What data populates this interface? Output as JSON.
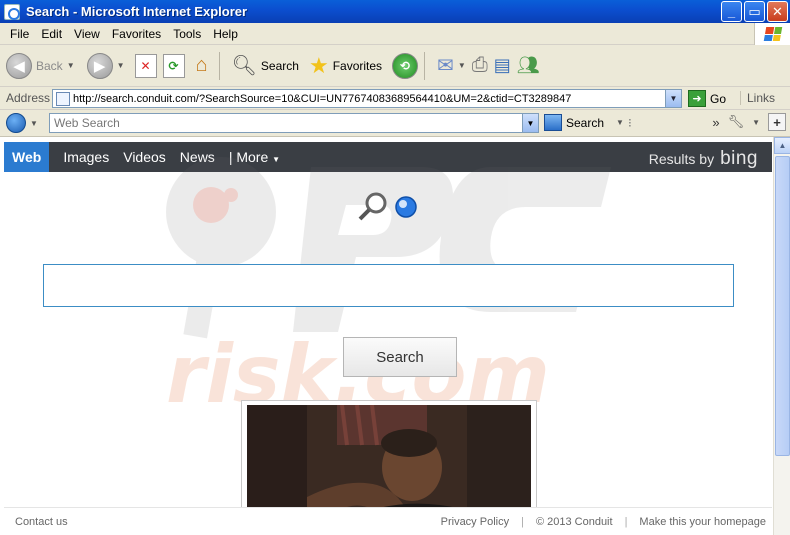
{
  "window": {
    "title": "Search - Microsoft Internet Explorer"
  },
  "menu": [
    "File",
    "Edit",
    "View",
    "Favorites",
    "Tools",
    "Help"
  ],
  "toolbar": {
    "back_label": "Back",
    "search_label": "Search",
    "favorites_label": "Favorites"
  },
  "address": {
    "label": "Address",
    "url": "http://search.conduit.com/?SearchSource=10&CUI=UN77674083689564410&UM=2&ctid=CT3289847",
    "go_label": "Go",
    "links_label": "Links"
  },
  "conduit_toolbar": {
    "placeholder": "Web Search",
    "search_label": "Search"
  },
  "page": {
    "nav": {
      "active": "Web",
      "items": [
        "Images",
        "Videos",
        "News"
      ],
      "more": "| More",
      "results_by": "Results by",
      "engine": "bing"
    },
    "search_button": "Search",
    "watermark": {
      "top": "PC",
      "bottom": "risk.com"
    },
    "footer": {
      "contact": "Contact us",
      "privacy": "Privacy Policy",
      "copyright": "© 2013 Conduit",
      "homepage": "Make this your homepage"
    }
  },
  "colors": {
    "title_bar": "#0a4fd0",
    "nav_bg": "#3a3e44",
    "nav_active": "#2b7bd0",
    "search_border": "#3c8dc5"
  }
}
